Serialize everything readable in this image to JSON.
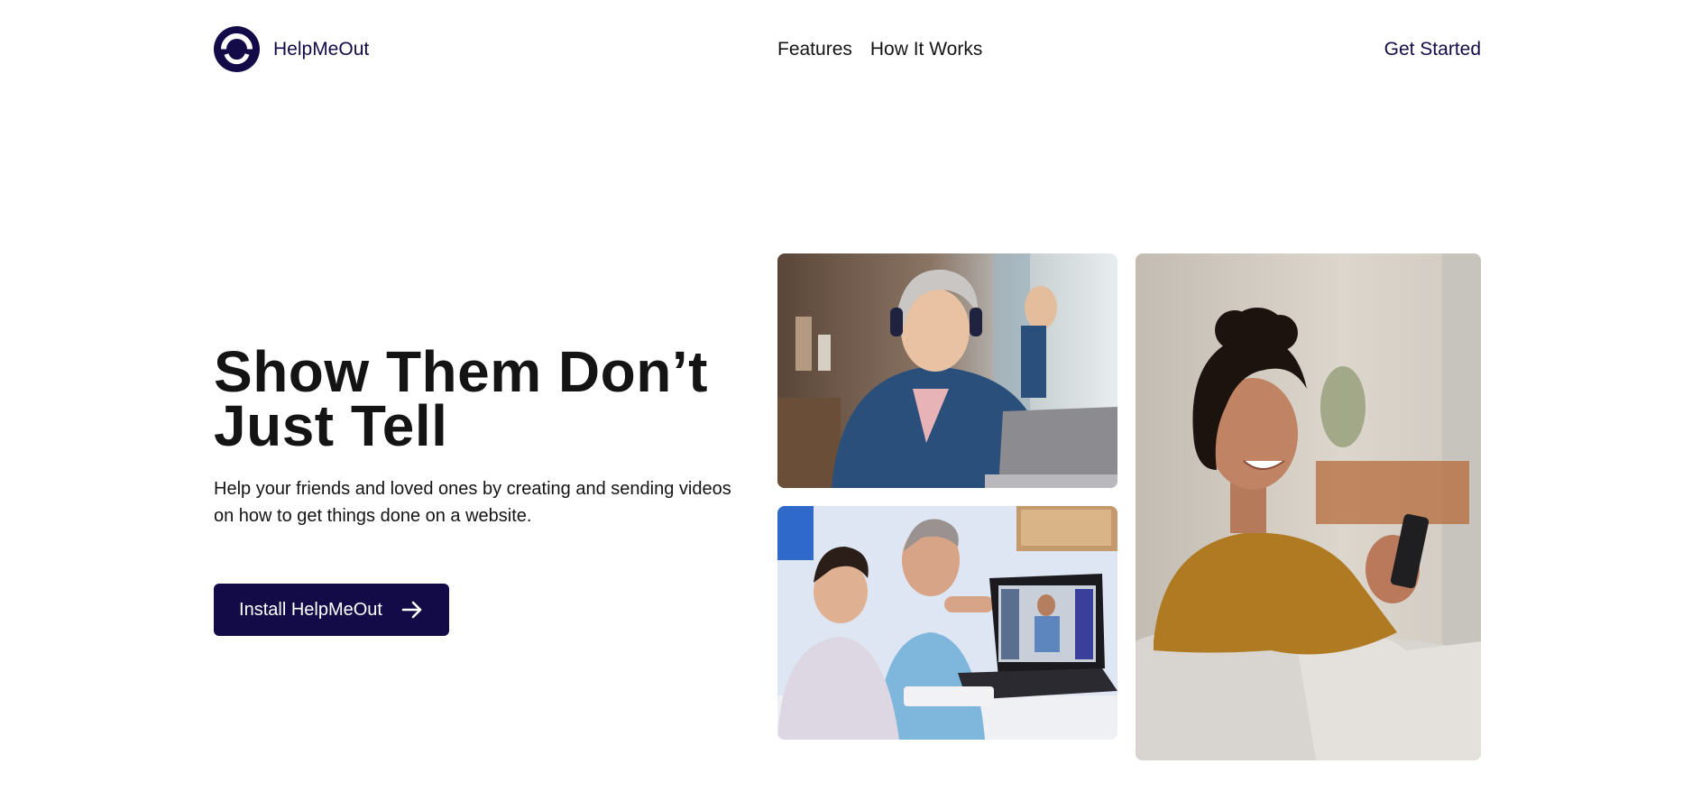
{
  "brand": {
    "name": "HelpMeOut",
    "color": "#120B48",
    "logo_icon": "ring-logo-icon"
  },
  "nav": {
    "items": [
      {
        "label": "Features"
      },
      {
        "label": "How It Works"
      }
    ],
    "cta_label": "Get Started"
  },
  "hero": {
    "headline_line1": "Show Them Don’t",
    "headline_line2": "Just Tell",
    "subtext_line1": "Help your friends and loved ones by creating and sending videos",
    "subtext_line2": "on how to get things done on a website.",
    "button_label": "Install HelpMeOut",
    "button_icon": "arrow-right-icon"
  },
  "images": [
    {
      "icon": "photo-woman-headphones-laptop-icon"
    },
    {
      "icon": "photo-man-boy-laptop-icon"
    },
    {
      "icon": "photo-woman-smiling-phone-icon"
    }
  ]
}
